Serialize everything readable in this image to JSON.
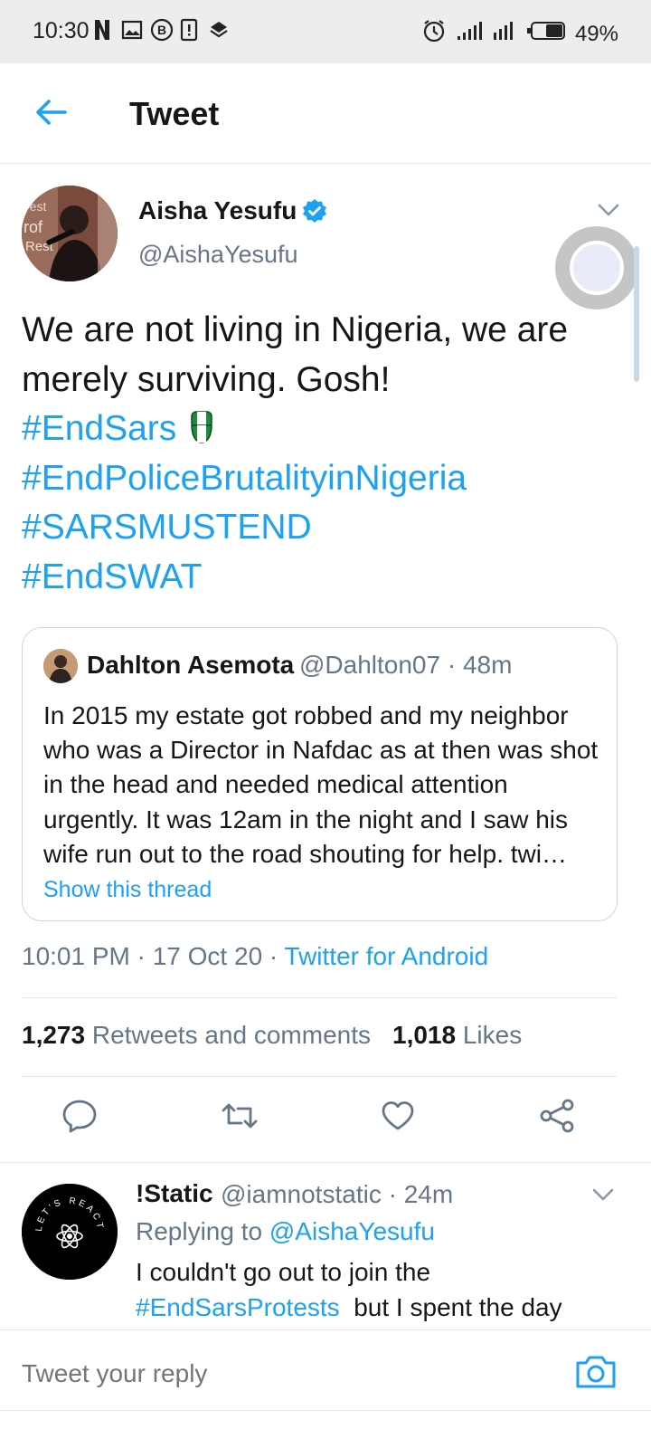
{
  "status_bar": {
    "time": "10:30",
    "battery": "49%",
    "icons": [
      "netflix-icon",
      "image-icon",
      "b-icon",
      "sim-icon",
      "layers-icon",
      "alarm-icon",
      "signal-icon",
      "signal-icon-2",
      "battery-icon"
    ]
  },
  "appbar": {
    "title": "Tweet",
    "back_icon": "arrow-left-icon"
  },
  "tweet": {
    "author_name": "Aisha Yesufu",
    "author_handle": "@AishaYesufu",
    "text": "We are not living in Nigeria, we are merely surviving. Gosh!",
    "hashtags": [
      "#EndSars",
      "#EndPoliceBrutalityinNigeria",
      "#SARSMUSTEND",
      "#EndSWAT"
    ],
    "quoted": {
      "name": "Dahlton Asemota",
      "meta": "@Dahlton07 · 48m",
      "text": "In 2015 my estate got robbed and my neighbor who was a Director in Nafdac as at then was shot in the head and needed medical attention urgently. It was 12am in the night and I saw his wife run out to the road shouting for help. twi…",
      "thread_link": "Show this thread"
    },
    "time": "10:01 PM · 17 Oct 20 · ",
    "source": "Twitter for Android",
    "retweets_count": "1,273",
    "retweets_label": "Retweets and comments",
    "likes_count": "1,018",
    "likes_label": "Likes"
  },
  "reply": {
    "name": "!Static",
    "meta": "@iamnotstatic · 24m",
    "replying_prefix": "Replying to ",
    "replying_handle": "@AishaYesufu",
    "text_line1": "I couldn't go out to join the",
    "hashtag": "#EndSarsProtests",
    "text_after_tag": "  but I spent the day",
    "avatar_text": "LET'S REACT"
  },
  "reply_bar": {
    "placeholder": "Tweet your reply"
  },
  "colors": {
    "accent": "#1da1f2",
    "secondary_text": "#657786",
    "primary_text": "#14171a"
  }
}
